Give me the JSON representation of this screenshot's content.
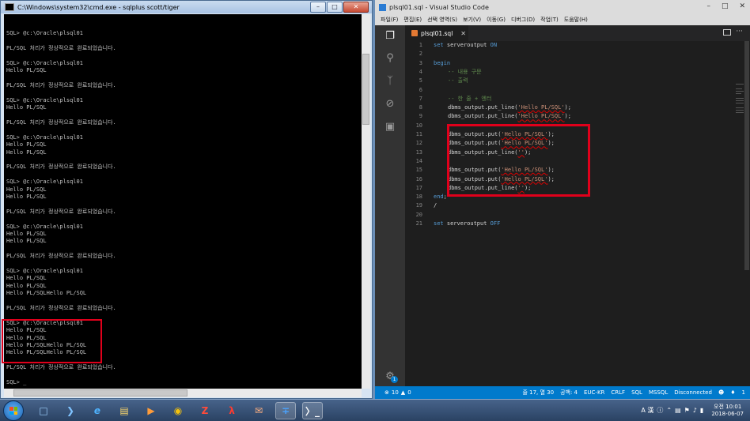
{
  "cmd": {
    "title": "C:\\Windows\\system32\\cmd.exe - sqlplus  scott/tiger",
    "lines": [
      "SQL> @c:\\Oracle\\plsql01",
      "",
      "PL/SQL 처리가 정상적으로 완료되었습니다.",
      "",
      "SQL> @c:\\Oracle\\plsql01",
      "Hello PL/SQL",
      "",
      "PL/SQL 처리가 정상적으로 완료되었습니다.",
      "",
      "SQL> @c:\\Oracle\\plsql01",
      "Hello PL/SQL",
      "",
      "PL/SQL 처리가 정상적으로 완료되었습니다.",
      "",
      "SQL> @c:\\Oracle\\plsql01",
      "Hello PL/SQL",
      "Hello PL/SQL",
      "",
      "PL/SQL 처리가 정상적으로 완료되었습니다.",
      "",
      "SQL> @c:\\Oracle\\plsql01",
      "Hello PL/SQL",
      "Hello PL/SQL",
      "",
      "PL/SQL 처리가 정상적으로 완료되었습니다.",
      "",
      "SQL> @c:\\Oracle\\plsql01",
      "Hello PL/SQL",
      "Hello PL/SQL",
      "",
      "PL/SQL 처리가 정상적으로 완료되었습니다.",
      "",
      "SQL> @c:\\Oracle\\plsql01",
      "Hello PL/SQL",
      "Hello PL/SQL",
      "Hello PL/SQLHello PL/SQL",
      "",
      "PL/SQL 처리가 정상적으로 완료되었습니다.",
      "",
      "SQL> @c:\\Oracle\\plsql01",
      "Hello PL/SQL",
      "Hello PL/SQL",
      "Hello PL/SQLHello PL/SQL",
      "Hello PL/SQLHello PL/SQL",
      "",
      "PL/SQL 처리가 정상적으로 완료되었습니다.",
      "",
      "SQL> _"
    ],
    "hscroll_marker": "III"
  },
  "vscode": {
    "title": "plsql01.sql - Visual Studio Code",
    "menu": [
      "파일(F)",
      "편집(E)",
      "선택 영역(S)",
      "보기(V)",
      "이동(G)",
      "디버그(D)",
      "작업(T)",
      "도움말(H)"
    ],
    "tab_name": "plsql01.sql",
    "code": [
      {
        "n": "1",
        "i": 0,
        "parts": [
          [
            "kw",
            "set"
          ],
          [
            "tx",
            " serveroutput "
          ],
          [
            "kw",
            "ON"
          ]
        ]
      },
      {
        "n": "2",
        "i": 0,
        "parts": []
      },
      {
        "n": "3",
        "i": 0,
        "parts": [
          [
            "kw",
            "begin"
          ]
        ]
      },
      {
        "n": "4",
        "i": 1,
        "parts": [
          [
            "cm",
            "-- 내용 구문"
          ]
        ]
      },
      {
        "n": "5",
        "i": 1,
        "parts": [
          [
            "cm",
            "-- 출력"
          ]
        ]
      },
      {
        "n": "6",
        "i": 0,
        "parts": []
      },
      {
        "n": "7",
        "i": 1,
        "parts": [
          [
            "cm",
            "-- 한 줄 + 엔터"
          ]
        ]
      },
      {
        "n": "8",
        "i": 1,
        "parts": [
          [
            "tx",
            "dbms_output.put_line("
          ],
          [
            "st",
            "'Hello PL/SQL'"
          ],
          [
            "tx",
            ");"
          ]
        ]
      },
      {
        "n": "9",
        "i": 1,
        "parts": [
          [
            "tx",
            "dbms_output.put_line("
          ],
          [
            "st",
            "'Hello PL/SQL'"
          ],
          [
            "tx",
            ");"
          ]
        ]
      },
      {
        "n": "10",
        "i": 0,
        "parts": []
      },
      {
        "n": "11",
        "i": 1,
        "parts": [
          [
            "tx",
            "dbms_output.put("
          ],
          [
            "st",
            "'Hello PL/SQL'"
          ],
          [
            "tx",
            ");"
          ]
        ]
      },
      {
        "n": "12",
        "i": 1,
        "parts": [
          [
            "tx",
            "dbms_output.put("
          ],
          [
            "st",
            "'Hello PL/SQL'"
          ],
          [
            "tx",
            ");"
          ]
        ]
      },
      {
        "n": "13",
        "i": 1,
        "parts": [
          [
            "tx",
            "dbms_output.put_line("
          ],
          [
            "st",
            "''"
          ],
          [
            "tx",
            ");"
          ]
        ]
      },
      {
        "n": "14",
        "i": 0,
        "parts": []
      },
      {
        "n": "15",
        "i": 1,
        "parts": [
          [
            "tx",
            "dbms_output.put("
          ],
          [
            "st",
            "'Hello PL/SQL'"
          ],
          [
            "tx",
            ");"
          ]
        ]
      },
      {
        "n": "16",
        "i": 1,
        "parts": [
          [
            "tx",
            "dbms_output.put("
          ],
          [
            "st",
            "'Hello PL/SQL'"
          ],
          [
            "tx",
            ");"
          ]
        ]
      },
      {
        "n": "17",
        "i": 1,
        "parts": [
          [
            "tx",
            "dbms_output.put_line("
          ],
          [
            "st",
            "''"
          ],
          [
            "tx",
            ");"
          ]
        ]
      },
      {
        "n": "18",
        "i": 0,
        "parts": [
          [
            "kw",
            "end"
          ],
          [
            "tx",
            ";"
          ]
        ]
      },
      {
        "n": "19",
        "i": 0,
        "parts": [
          [
            "tx",
            "/"
          ]
        ]
      },
      {
        "n": "20",
        "i": 0,
        "parts": []
      },
      {
        "n": "21",
        "i": 0,
        "parts": [
          [
            "kw",
            "set"
          ],
          [
            "tx",
            " serveroutput "
          ],
          [
            "kw",
            "OFF"
          ]
        ]
      }
    ],
    "status": {
      "errors": "10",
      "warnings": "0",
      "position": "줄 17, 열 30",
      "spaces": "공백: 4",
      "encoding": "EUC-KR",
      "eol": "CRLF",
      "language": "SQL",
      "dialect": "MSSQL",
      "connection": "Disconnected",
      "notifications": "1"
    },
    "settings_badge": "1"
  },
  "taskbar": {
    "apps": [
      "explorer-icon",
      "powershell-icon",
      "ie-icon",
      "folder-icon",
      "media-player-icon",
      "chrome-icon",
      "filezilla-icon",
      "acrobat-icon",
      "outlook-icon",
      "vscode-icon",
      "cmd-icon"
    ],
    "ime": "A 漢",
    "clock_time": "오전 10:01",
    "clock_date": "2018-06-07"
  },
  "colors": {
    "highlight": "#e0001b",
    "vscode_status": "#007acc",
    "keyword": "#569cd6",
    "comment": "#608b4e",
    "string": "#ce9178"
  }
}
